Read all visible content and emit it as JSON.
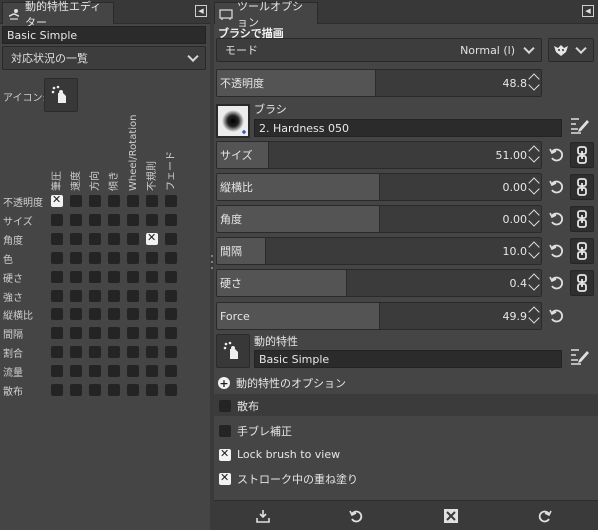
{
  "left_panel": {
    "tab_title": "動的特性エディター",
    "tab_icon": "dynamics-icon",
    "name_value": "Basic Simple",
    "mapping_combo": "対応状況の一覧",
    "icon_label": "アイコン:",
    "columns": [
      "筆圧",
      "速度",
      "方向",
      "傾き",
      "Wheel/Rotation",
      "不規則",
      "フェード"
    ],
    "rows": [
      "不透明度",
      "サイズ",
      "角度",
      "色",
      "硬さ",
      "強さ",
      "縦横比",
      "間隔",
      "割合",
      "流量",
      "散布"
    ],
    "checked": [
      {
        "row": "不透明度",
        "column": "筆圧"
      },
      {
        "row": "角度",
        "column": "不規則"
      }
    ]
  },
  "right_panel": {
    "tab_title": "ツールオプション",
    "tab_icon": "tool-options-icon",
    "section_title": "ブラシで描画",
    "mode_label": "モード",
    "mode_value": "Normal (l)",
    "sliders": [
      {
        "label": "不透明度",
        "value": "48.8",
        "fraction": 0.488
      },
      {
        "label": "サイズ",
        "value": "51.00",
        "fraction": 0.16
      },
      {
        "label": "縦横比",
        "value": "0.00",
        "fraction": 0.5
      },
      {
        "label": "角度",
        "value": "0.00",
        "fraction": 0.5
      },
      {
        "label": "間隔",
        "value": "10.0",
        "fraction": 0.15
      },
      {
        "label": "硬さ",
        "value": "0.4",
        "fraction": 0.4
      },
      {
        "label": "Force",
        "value": "49.9",
        "fraction": 0.499
      }
    ],
    "brush_label": "ブラシ",
    "brush_name": "2. Hardness 050",
    "dynamics_label": "動的特性",
    "dynamics_name": "Basic Simple",
    "dynamics_options": "動的特性のオプション",
    "scatter_label": "散布",
    "smooth_label": "手ブレ補正",
    "lock_label": "Lock brush to view",
    "incremental_label": "ストローク中の重ね塗り",
    "checks": {
      "scatter": false,
      "smooth": false,
      "lock": true,
      "incremental": true
    }
  }
}
